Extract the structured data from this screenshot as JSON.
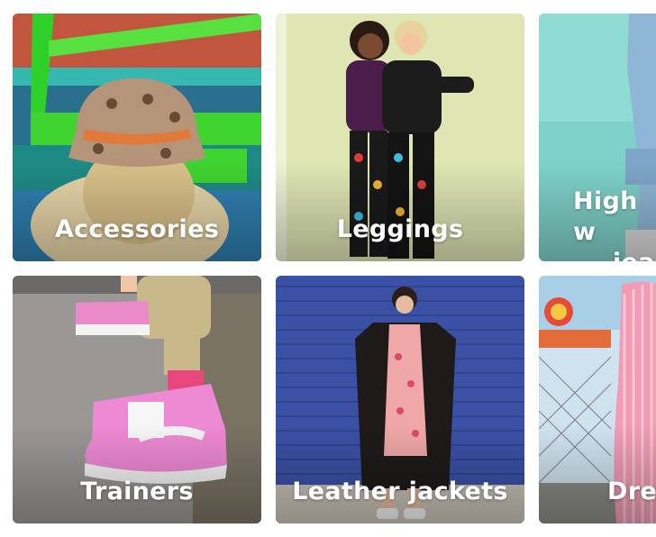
{
  "categories": [
    {
      "label": "Accessories"
    },
    {
      "label": "Leggings"
    },
    {
      "label": "High w… jea…",
      "line1": "High w",
      "line2": "jea"
    },
    {
      "label": "Trainers"
    },
    {
      "label": "Leather jackets"
    },
    {
      "label": "Dre"
    }
  ],
  "colors": {
    "label_text": "#ffffff",
    "page_background": "#ffffff"
  }
}
